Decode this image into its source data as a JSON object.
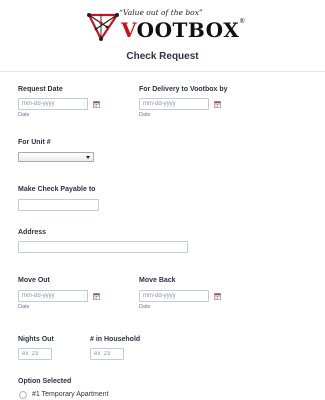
{
  "brand": {
    "tagline": "“Value out of the box”",
    "wordmark_first": "V",
    "wordmark_rest": "OOTBOX",
    "trademark": "®"
  },
  "form": {
    "title": "Check Request",
    "request_date": {
      "label": "Request Date",
      "placeholder": "mm-dd-yyyy",
      "sublabel": "Date"
    },
    "delivery_date": {
      "label": "For Delivery to Vootbox by",
      "placeholder": "mm-dd-yyyy",
      "sublabel": "Date"
    },
    "unit": {
      "label": "For Unit #",
      "selected": ""
    },
    "payable_to": {
      "label": "Make Check Payable to",
      "value": ""
    },
    "address": {
      "label": "Address",
      "value": ""
    },
    "move_out": {
      "label": "Move Out",
      "placeholder": "mm-dd-yyyy",
      "sublabel": "Date"
    },
    "move_back": {
      "label": "Move Back",
      "placeholder": "mm-dd-yyyy",
      "sublabel": "Date"
    },
    "nights_out": {
      "label": "Nights Out",
      "placeholder": "ex: 23"
    },
    "household": {
      "label": "# in Household",
      "placeholder": "ex: 23"
    },
    "option": {
      "label": "Option Selected",
      "choices": [
        "#1 Temporary Apartment"
      ]
    }
  },
  "colors": {
    "brand_red": "#c4161c",
    "label_text": "#2c3345",
    "sublabel_text": "#6f76a7",
    "input_border": "#c3cad8"
  }
}
